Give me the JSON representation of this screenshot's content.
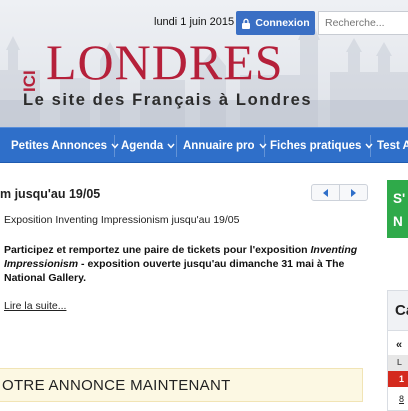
{
  "header": {
    "date": "lundi 1 juin 2015",
    "login_label": "Connexion",
    "search_placeholder": "Recherche...",
    "logo_prefix": "ICI",
    "logo_main": "LONDRES",
    "tagline": "Le site des Français à Londres"
  },
  "nav": {
    "items": [
      {
        "label": "Petites Annonces"
      },
      {
        "label": "Agenda"
      },
      {
        "label": "Annuaire pro"
      },
      {
        "label": "Fiches pratiques"
      },
      {
        "label": "Test A"
      }
    ]
  },
  "article": {
    "title": "m jusqu'au 19/05",
    "subtitle": "Exposition Inventing Impressionism jusqu'au 19/05",
    "desc_part1": "Participez et remportez une paire de tickets pour l'exposition ",
    "desc_italic": "Inventing Impressionism",
    "desc_part2": " - exposition ouverte jusqu'au dimanche 31 mai à The National Gallery.",
    "read_more": "Lire la suite..."
  },
  "annonce": {
    "label": "OTRE ANNONCE MAINTENANT"
  },
  "sidebar": {
    "green_line1": "S'",
    "green_line2": "N",
    "widget_title": "Ca",
    "widget_arrow": "«",
    "widget_row1": "L",
    "widget_row2": "1",
    "widget_row3": "8"
  },
  "colors": {
    "nav_blue": "#2f6fc9",
    "logo_red": "#b5203a",
    "green": "#2faa4a",
    "annonce_bg": "#fcf8e3"
  },
  "icons": [
    "lock-icon",
    "chevron-down-icon",
    "arrow-left-icon",
    "arrow-right-icon"
  ]
}
